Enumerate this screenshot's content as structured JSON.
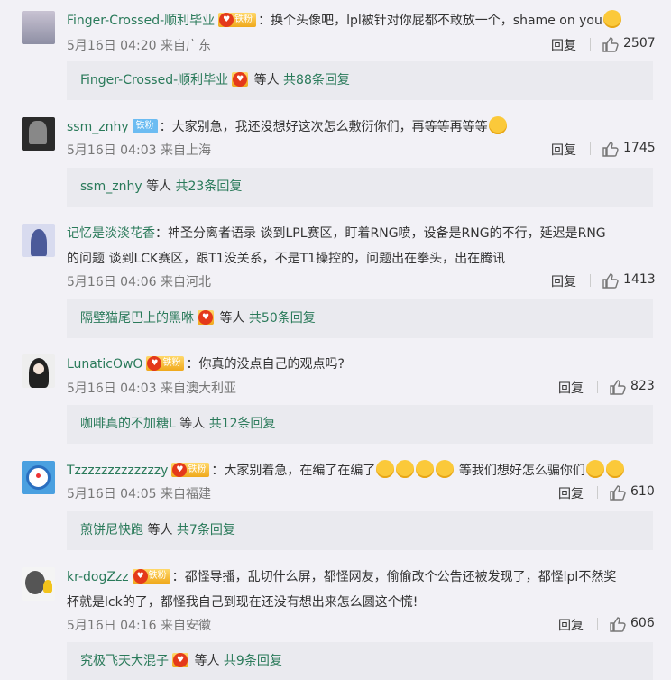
{
  "comments": [
    {
      "user": "Finger-Crossed-顺利毕业",
      "badge": "铁粉",
      "badge_type": "gold",
      "text": "：换个头像吧，lpl被针对你屁都不敢放一个，shame on you",
      "emoji_after": "hug-emoji",
      "time": "5月16日 04:20 来自广东",
      "reply_label": "回复",
      "likes": "2507",
      "sub_user": "Finger-Crossed-顺利毕业",
      "sub_mid": "等人",
      "sub_count": "共88条回复"
    },
    {
      "user": "ssm_znhy",
      "badge": "铁粉",
      "badge_type": "blue",
      "text": "：大家别急，我还没想好这次怎么敷衍你们，再等等再等等",
      "emoji_after": "crying-emoji",
      "time": "5月16日 04:03 来自上海",
      "reply_label": "回复",
      "likes": "1745",
      "sub_user": "ssm_znhy",
      "sub_mid": "等人",
      "sub_count": "共23条回复"
    },
    {
      "user": "记忆是淡淡花香",
      "text_line1": "：神圣分离者语录 谈到LPL赛区，盯着RNG喷，设备是RNG的不行，延迟是RNG",
      "text_line2": "的问题 谈到LCK赛区，跟T1没关系，不是T1操控的，问题出在拳头，出在腾讯",
      "time": "5月16日 04:06 来自河北",
      "reply_label": "回复",
      "likes": "1413",
      "sub_user": "隔壁猫尾巴上的黑咻",
      "sub_mid": "等人",
      "sub_count": "共50条回复"
    },
    {
      "user": "LunaticOwO",
      "badge": "铁粉",
      "badge_type": "gold",
      "text": "：你真的没点自己的观点吗?",
      "time": "5月16日 04:03 来自澳大利亚",
      "reply_label": "回复",
      "likes": "823",
      "sub_user": "咖啡真的不加糖L",
      "sub_mid": "等人",
      "sub_count": "共12条回复"
    },
    {
      "user": "Tzzzzzzzzzzzzzy",
      "badge": "铁粉",
      "badge_type": "gold",
      "text_a": "：大家别着急，在编了在编了",
      "text_b": " 等我们想好怎么骗你们",
      "time": "5月16日 04:05 来自福建",
      "reply_label": "回复",
      "likes": "610",
      "sub_user": "煎饼尼快跑",
      "sub_mid": "等人",
      "sub_count": "共7条回复"
    },
    {
      "user": "kr-dogZzz",
      "badge": "铁粉",
      "badge_type": "gold",
      "text_line1": "：都怪导播，乱切什么屏，都怪网友，偷偷改个公告还被发现了，都怪lpl不然奖",
      "text_line2": "杯就是lck的了，都怪我自己到现在还没有想出来怎么圆这个慌!",
      "time": "5月16日 04:16 来自安徽",
      "reply_label": "回复",
      "likes": "606",
      "sub_user": "究极飞天大混子",
      "sub_mid": "等人",
      "sub_count": "共9条回复"
    }
  ],
  "colors": {
    "username": "#2a7a5a",
    "background": "#f2f1f6",
    "sub_box": "#eaeaef"
  }
}
